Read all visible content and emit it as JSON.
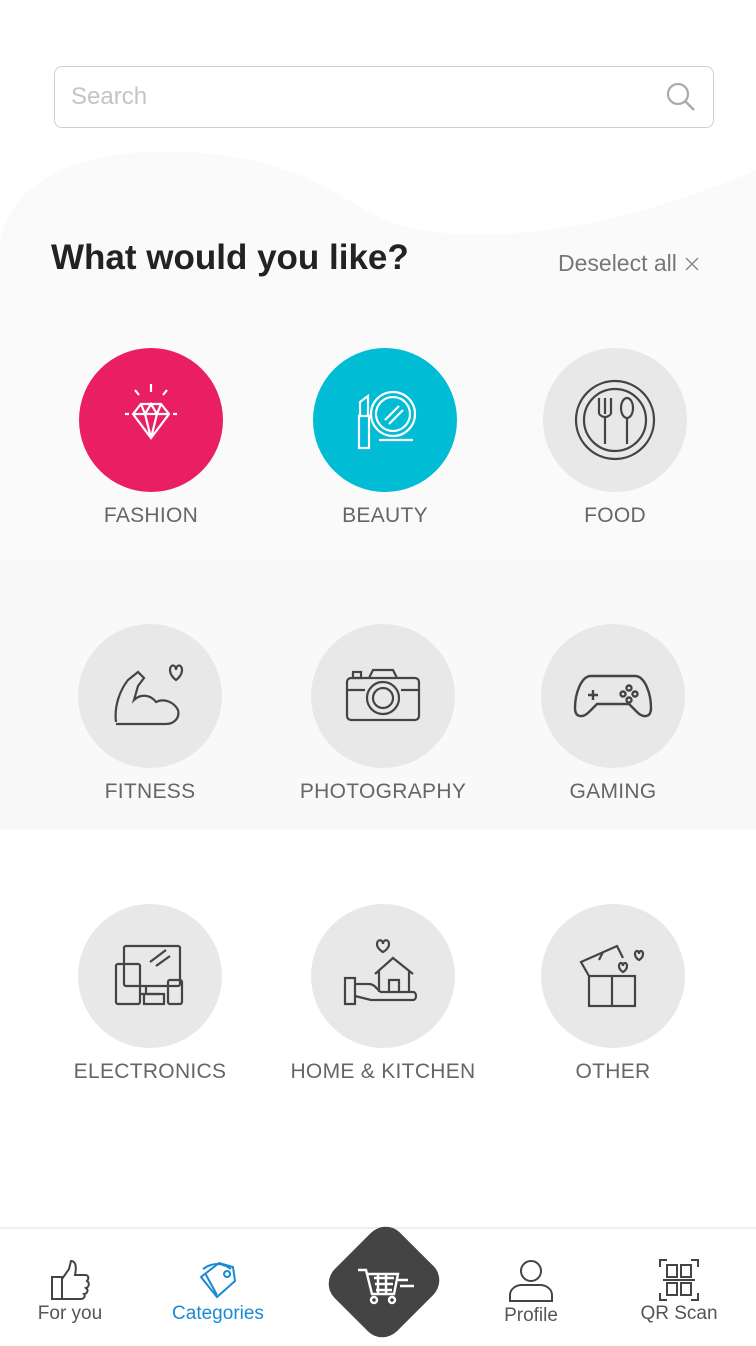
{
  "search": {
    "placeholder": "Search",
    "value": ""
  },
  "header": {
    "title": "What would you like?",
    "deselect_label": "Deselect all"
  },
  "categories": [
    {
      "label": "FASHION",
      "icon": "diamond-icon",
      "selected": true,
      "color": "#e91e63"
    },
    {
      "label": "BEAUTY",
      "icon": "lipstick-mirror-icon",
      "selected": true,
      "color": "#00bcd4"
    },
    {
      "label": "FOOD",
      "icon": "plate-cutlery-icon",
      "selected": false
    },
    {
      "label": "FITNESS",
      "icon": "muscle-arm-icon",
      "selected": false
    },
    {
      "label": "PHOTOGRAPHY",
      "icon": "camera-icon",
      "selected": false
    },
    {
      "label": "GAMING",
      "icon": "gamepad-icon",
      "selected": false
    },
    {
      "label": "ELECTRONICS",
      "icon": "devices-icon",
      "selected": false
    },
    {
      "label": "HOME & KITCHEN",
      "icon": "home-hand-icon",
      "selected": false
    },
    {
      "label": "OTHER",
      "icon": "gift-icon",
      "selected": false
    }
  ],
  "nav": {
    "items": [
      {
        "label": "For you",
        "icon": "thumbs-up-icon"
      },
      {
        "label": "Categories",
        "icon": "tag-icon",
        "active": true
      },
      {
        "label": "Profile",
        "icon": "user-icon"
      },
      {
        "label": "QR Scan",
        "icon": "qr-code-icon"
      }
    ],
    "center_icon": "cart-icon",
    "active_color": "#1a8ad4"
  }
}
